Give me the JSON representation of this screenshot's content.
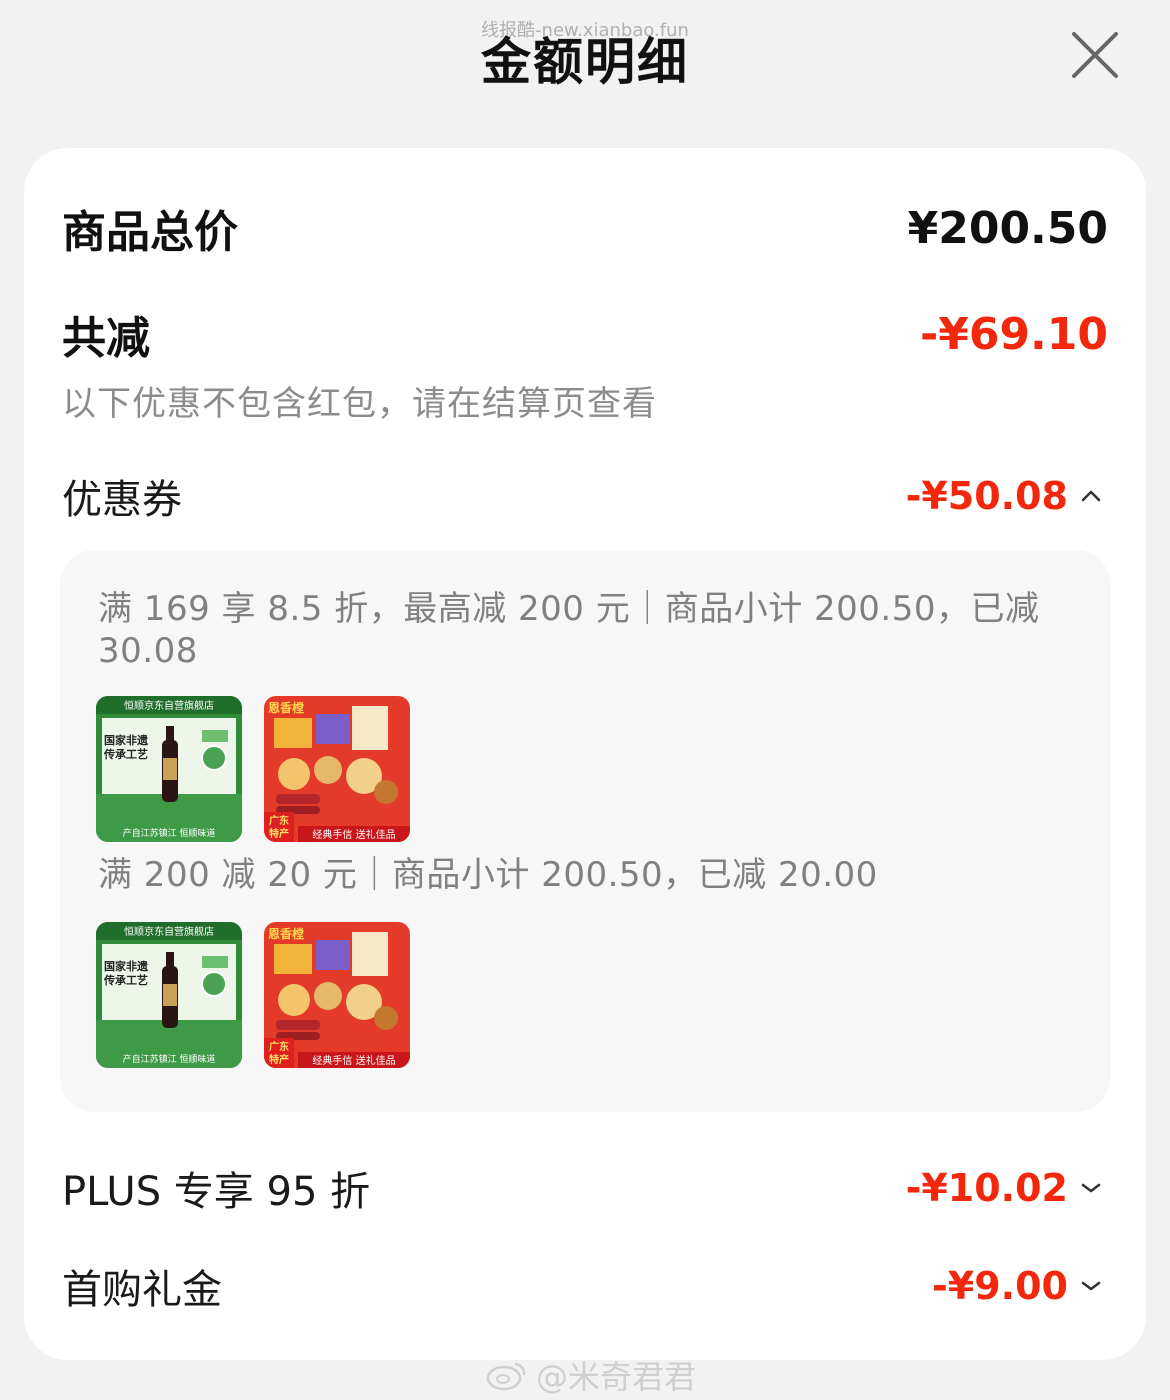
{
  "watermark_top": "线报酷-new.xianbao.fun",
  "title": "金额明细",
  "close_icon": "close-icon",
  "total": {
    "label": "商品总价",
    "value": "¥200.50"
  },
  "reduce": {
    "label": "共减",
    "value": "-¥69.10",
    "note": "以下优惠不包含红包，请在结算页查看"
  },
  "coupon": {
    "label": "优惠券",
    "value": "-¥50.08",
    "expanded": true,
    "rules": [
      {
        "text": "满 169 享 8.5 折，最高减 200 元｜商品小计 200.50，已减 30.08",
        "products": [
          {
            "image": "product-vinegar-image",
            "store": "恒顺京东自营旗舰店",
            "tag": "国家非遗 传承工艺",
            "footer": "产自江苏镇江 恒顺味道"
          },
          {
            "image": "product-giftbox-image",
            "brand": "恩香樘",
            "tag": "广东特产",
            "footer": "经典手信 送礼佳品"
          }
        ]
      },
      {
        "text": "满 200 减 20 元｜商品小计 200.50，已减 20.00",
        "products": [
          {
            "image": "product-vinegar-image",
            "store": "恒顺京东自营旗舰店",
            "tag": "国家非遗 传承工艺",
            "footer": "产自江苏镇江 恒顺味道"
          },
          {
            "image": "product-giftbox-image",
            "brand": "恩香樘",
            "tag": "广东特产",
            "footer": "经典手信 送礼佳品"
          }
        ]
      }
    ]
  },
  "plus": {
    "label": "PLUS 专享 95 折",
    "value": "-¥10.02",
    "expanded": false
  },
  "first_gift": {
    "label": "首购礼金",
    "value": "-¥9.00",
    "expanded": false
  },
  "watermark_bottom": "@米奇君君",
  "colors": {
    "accent_red": "#f2270c",
    "card_bg": "#ffffff",
    "page_bg": "#f2f2f2",
    "coupon_box_bg": "#f7f7f7"
  }
}
